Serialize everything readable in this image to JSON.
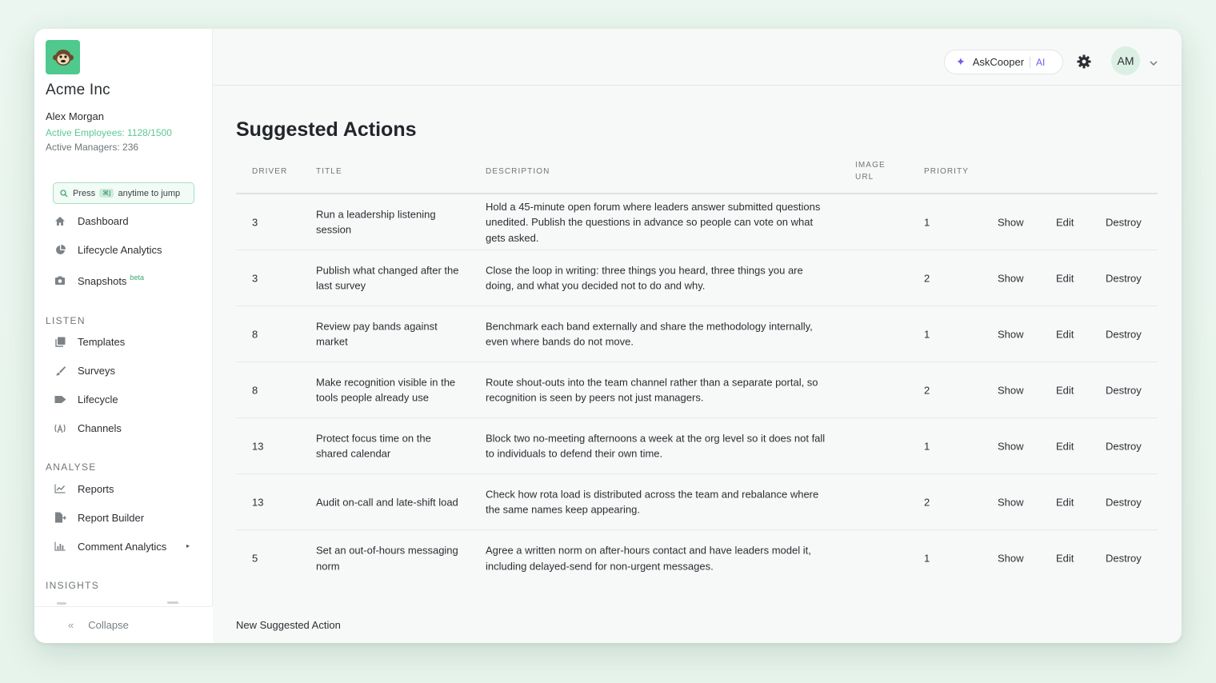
{
  "sidebar": {
    "org_name": "Acme Inc",
    "user_name": "Alex Morgan",
    "active_employees": "Active Employees: 1128/1500",
    "active_managers": "Active Managers: 236",
    "jump": {
      "press": "Press",
      "kbd": "⌘J",
      "rest": "anytime to jump"
    },
    "nav_top": [
      {
        "label": "Dashboard",
        "icon": "home-icon"
      },
      {
        "label": "Lifecycle Analytics",
        "icon": "pie-chart-icon"
      },
      {
        "label": "Snapshots",
        "badge": "beta",
        "icon": "camera-icon"
      }
    ],
    "listen_label": "LISTEN",
    "listen": [
      {
        "label": "Templates",
        "icon": "copy-icon"
      },
      {
        "label": "Surveys",
        "icon": "brush-icon"
      },
      {
        "label": "Lifecycle",
        "icon": "arrow-flow-icon"
      },
      {
        "label": "Channels",
        "icon": "broadcast-icon"
      }
    ],
    "analyse_label": "ANALYSE",
    "analyse": [
      {
        "label": "Reports",
        "icon": "line-chart-icon"
      },
      {
        "label": "Report Builder",
        "icon": "file-export-icon"
      },
      {
        "label": "Comment Analytics",
        "icon": "bar-chart-icon"
      }
    ],
    "insights_label": "INSIGHTS",
    "collapse": "Collapse",
    "collapse_icon": "«"
  },
  "topbar": {
    "ask_label": "AskCooper",
    "ask_ai": "AI",
    "avatar": "AM"
  },
  "page": {
    "title": "Suggested Actions",
    "new_link": "New Suggested Action"
  },
  "table": {
    "headers": {
      "driver": "DRIVER",
      "title": "TITLE",
      "description": "DESCRIPTION",
      "image_url_1": "IMAGE",
      "image_url_2": "URL",
      "priority": "PRIORITY"
    },
    "actions": {
      "show": "Show",
      "edit": "Edit",
      "destroy": "Destroy"
    },
    "rows": [
      {
        "driver": "3",
        "title": "Run a leadership listening session",
        "description": "Hold a 45-minute open forum where leaders answer submitted questions unedited. Publish the questions in advance so people can vote on what gets asked.",
        "priority": "1"
      },
      {
        "driver": "3",
        "title": "Publish what changed after the last survey",
        "description": "Close the loop in writing: three things you heard, three things you are doing, and what you decided not to do and why.",
        "priority": "2"
      },
      {
        "driver": "8",
        "title": "Review pay bands against market",
        "description": "Benchmark each band externally and share the methodology internally, even where bands do not move.",
        "priority": "1"
      },
      {
        "driver": "8",
        "title": "Make recognition visible in the tools people already use",
        "description": "Route shout-outs into the team channel rather than a separate portal, so recognition is seen by peers not just managers.",
        "priority": "2"
      },
      {
        "driver": "13",
        "title": "Protect focus time on the shared calendar",
        "description": "Block two no-meeting afternoons a week at the org level so it does not fall to individuals to defend their own time.",
        "priority": "1"
      },
      {
        "driver": "13",
        "title": "Audit on-call and late-shift load",
        "description": "Check how rota load is distributed across the team and rebalance where the same names keep appearing.",
        "priority": "2"
      },
      {
        "driver": "5",
        "title": "Set an out-of-hours messaging norm",
        "description": "Agree a written norm on after-hours contact and have leaders model it, including delayed-send for non-urgent messages.",
        "priority": "1"
      }
    ]
  }
}
